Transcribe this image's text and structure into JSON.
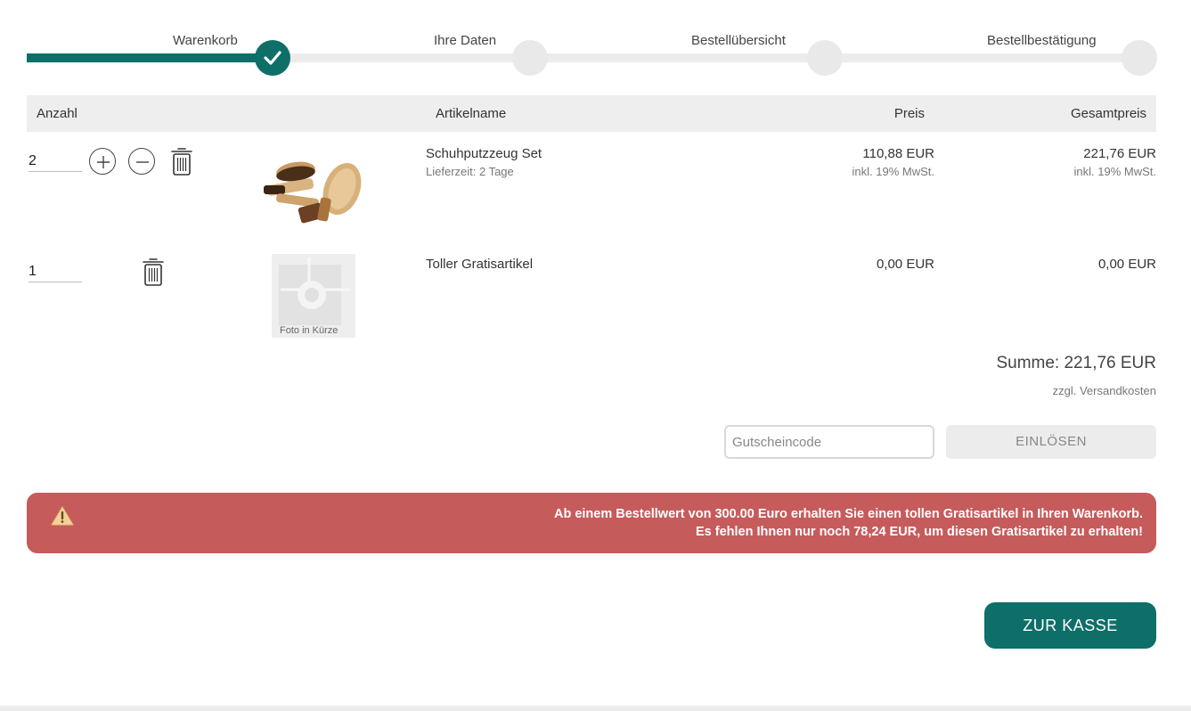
{
  "steps": [
    {
      "label": "Warenkorb",
      "state": "done"
    },
    {
      "label": "Ihre Daten",
      "state": "pending"
    },
    {
      "label": "Bestellübersicht",
      "state": "pending"
    },
    {
      "label": "Bestellbestätigung",
      "state": "pending"
    }
  ],
  "table": {
    "headers": {
      "qty": "Anzahl",
      "name": "Artikelname",
      "price": "Preis",
      "total": "Gesamtpreis"
    }
  },
  "items": [
    {
      "qty": "2",
      "name": "Schuhputzzeug Set",
      "delivery": "Lieferzeit: 2 Tage",
      "price": "110,88 EUR",
      "price_tax": "inkl. 19% MwSt.",
      "total": "221,76 EUR",
      "total_tax": "inkl. 19% MwSt.",
      "image_icon": "shoe-brush-set-image"
    },
    {
      "qty": "1",
      "name": "Toller Gratisartikel",
      "price": "0,00 EUR",
      "total": "0,00 EUR",
      "placeholder_text": "Foto in Kürze"
    }
  ],
  "summary": {
    "sum": "Summe: 221,76 EUR",
    "shipping": "zzgl. Versandkosten"
  },
  "coupon": {
    "placeholder": "Gutscheincode",
    "button": "EINLÖSEN"
  },
  "alert": {
    "line1": "Ab einem Bestellwert von 300.00 Euro erhalten Sie einen tollen Gratisartikel in Ihren Warenkorb.",
    "line2": "Es fehlen Ihnen nur noch 78,24 EUR, um diesen Gratisartikel zu erhalten!",
    "icon": "warning-icon"
  },
  "checkout": {
    "label": "ZUR KASSE"
  },
  "colors": {
    "primary": "#0e6f69",
    "alert": "#c65b5c",
    "track": "#ececec"
  }
}
